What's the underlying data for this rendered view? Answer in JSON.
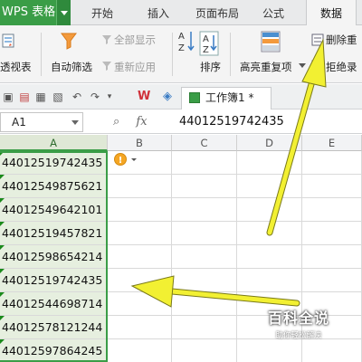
{
  "app": {
    "name": "WPS 表格",
    "accent": "#3a9d47"
  },
  "tabs": [
    {
      "label": "开始"
    },
    {
      "label": "插入"
    },
    {
      "label": "页面布局"
    },
    {
      "label": "公式"
    },
    {
      "label": "数据",
      "active": true
    }
  ],
  "ribbon": {
    "pivot_label": "透视表",
    "autofilter_label": "自动筛选",
    "show_all_label": "全部显示",
    "reapply_label": "重新应用",
    "sort_label": "排序",
    "highlight_dup_label": "高亮重复项",
    "delete_dup_label": "删除重",
    "reject_label": "拒绝录"
  },
  "document": {
    "tab_title": "工作簿1 *"
  },
  "formula_bar": {
    "name_box": "A1",
    "fx_label": "fx",
    "value": "44012519742435"
  },
  "columns": [
    "A",
    "B",
    "C",
    "D",
    "E"
  ],
  "cells_a": [
    "44012519742435",
    "44012549875621",
    "44012549642101",
    "44012519457821",
    "44012598654214",
    "44012519742435",
    "44012544698714",
    "44012578121244",
    "44012597864245"
  ],
  "watermark": {
    "title": "百科全说",
    "subtitle": "助你轻松解决"
  },
  "colors": {
    "arrow": "#f2f032",
    "selection": "#3a9d47",
    "selected_fill": "#e6efdf"
  }
}
